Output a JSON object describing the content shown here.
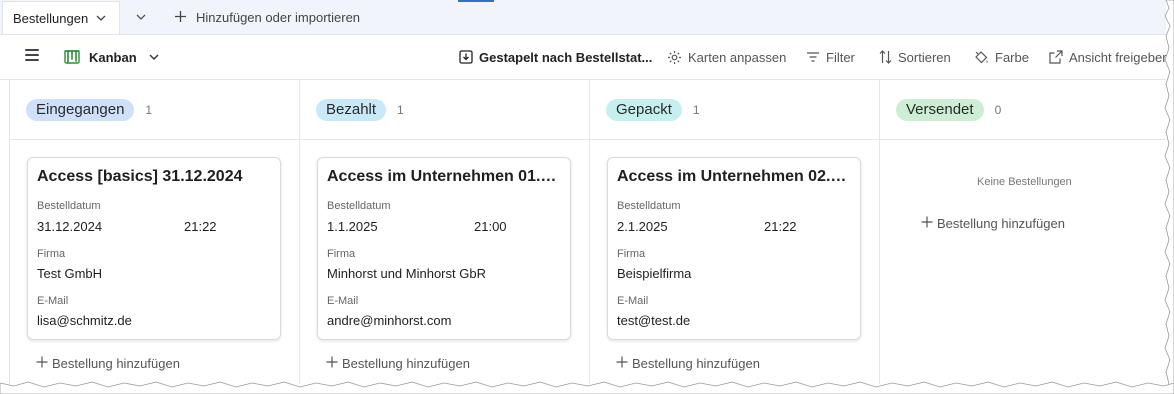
{
  "tabs": {
    "active_label": "Bestellungen",
    "add_label": "Hinzufügen oder importieren"
  },
  "toolbar": {
    "view_label": "Kanban",
    "stacked_label": "Gestapelt nach Bestellstat...",
    "customize_cards_label": "Karten anpassen",
    "filter_label": "Filter",
    "sort_label": "Sortieren",
    "color_label": "Farbe",
    "share_view_label": "Ansicht freigeber"
  },
  "colors": {
    "eingegangen": "#cfe0fb",
    "bezahlt": "#c9e9f9",
    "gepackt": "#c6f0f0",
    "versendet": "#cdeed2",
    "kanban_icon": "#2e8b3a"
  },
  "columns": [
    {
      "name": "Eingegangen",
      "count": "1",
      "add_label": "Bestellung hinzufügen",
      "card": {
        "title": "Access [basics] 31.12.2024",
        "date_label": "Bestelldatum",
        "date": "31.12.2024",
        "time": "21:22",
        "company_label": "Firma",
        "company": "Test GmbH",
        "email_label": "E-Mail",
        "email": "lisa@schmitz.de"
      }
    },
    {
      "name": "Bezahlt",
      "count": "1",
      "add_label": "Bestellung hinzufügen",
      "card": {
        "title": "Access im Unternehmen 01.01....",
        "date_label": "Bestelldatum",
        "date": "1.1.2025",
        "time": "21:00",
        "company_label": "Firma",
        "company": "Minhorst und Minhorst GbR",
        "email_label": "E-Mail",
        "email": "andre@minhorst.com"
      }
    },
    {
      "name": "Gepackt",
      "count": "1",
      "add_label": "Bestellung hinzufügen",
      "card": {
        "title": "Access im Unternehmen 02.01....",
        "date_label": "Bestelldatum",
        "date": "2.1.2025",
        "time": "21:22",
        "company_label": "Firma",
        "company": "Beispielfirma",
        "email_label": "E-Mail",
        "email": "test@test.de"
      }
    },
    {
      "name": "Versendet",
      "count": "0",
      "empty_label": "Keine Bestellungen",
      "add_label": "Bestellung hinzufügen"
    }
  ]
}
